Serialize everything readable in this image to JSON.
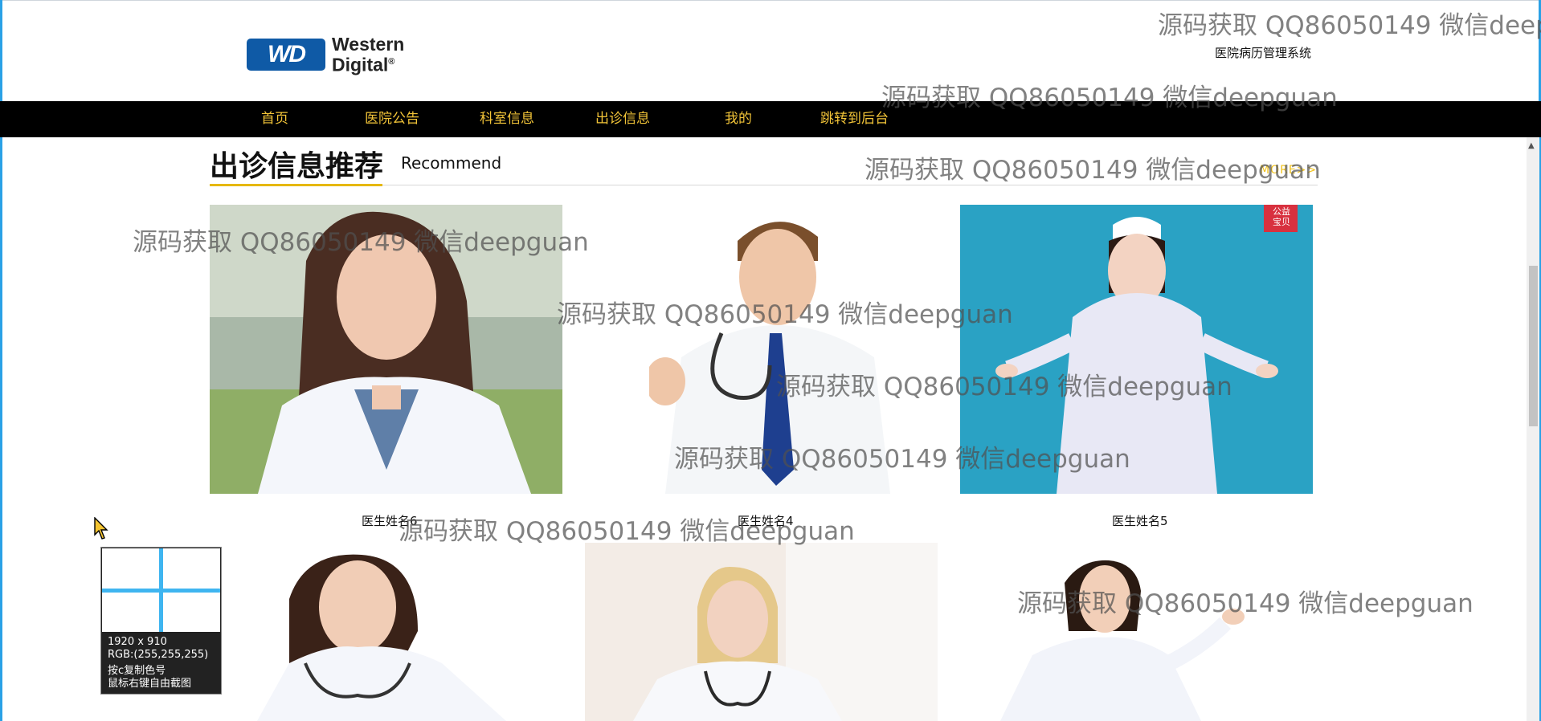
{
  "header": {
    "logo": {
      "badge": "WD",
      "line1": "Western",
      "line2": "Digital",
      "reg": "®"
    },
    "site_title": "医院病历管理系统"
  },
  "nav": {
    "items": [
      {
        "label": "首页"
      },
      {
        "label": "医院公告"
      },
      {
        "label": "科室信息"
      },
      {
        "label": "出诊信息"
      },
      {
        "label": "我的"
      },
      {
        "label": "跳转到后台"
      }
    ]
  },
  "section": {
    "title": "出诊信息推荐",
    "subtitle": "Recommend",
    "more": "MORE>>"
  },
  "cards": [
    {
      "name": "医生姓名6"
    },
    {
      "name": "医生姓名4"
    },
    {
      "name": "医生姓名5"
    },
    {
      "name": ""
    },
    {
      "name": ""
    },
    {
      "name": ""
    }
  ],
  "badge": {
    "line1": "公益",
    "line2": "宝贝"
  },
  "watermark": {
    "text": "源码获取 QQ86050149 微信deepguan",
    "text_cut": "源码获取 QQ86050149 微信deepg"
  },
  "picker": {
    "size": "1920 x 910",
    "rgb": "RGB:(255,255,255)",
    "hint1": "按c复制色号",
    "hint2": "鼠标右键自由截图"
  },
  "colors": {
    "nav_bg": "#000000",
    "nav_text": "#f2c438",
    "accent": "#e6b800",
    "window_border": "#2aa1e6"
  }
}
